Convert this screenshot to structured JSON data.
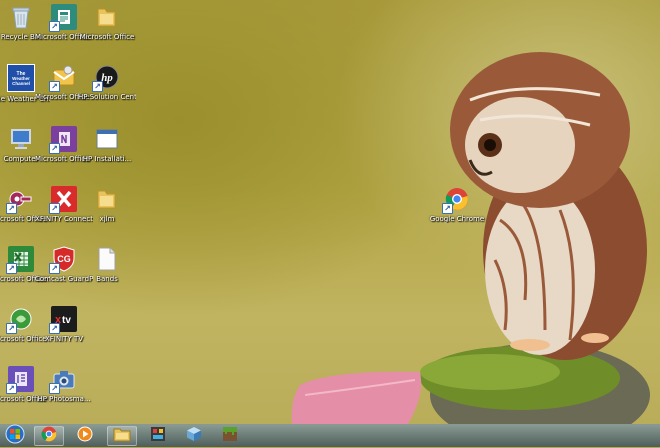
{
  "desktop": {
    "icons": [
      {
        "label": "Recycle Bin",
        "icon": "recycle-bin-icon"
      },
      {
        "label": "Microsoft Office P...",
        "icon": "office-publisher-icon"
      },
      {
        "label": "Microsoft Office",
        "icon": "folder-icon"
      },
      {
        "label": "The Weather Channel App",
        "icon": "weather-channel-icon"
      },
      {
        "label": "Microsoft Office Outl...",
        "icon": "outlook-icon"
      },
      {
        "label": "HP Solution Center",
        "icon": "hp-icon"
      },
      {
        "label": "Computer",
        "icon": "computer-icon"
      },
      {
        "label": "Microsoft Office ...",
        "icon": "onenote-icon"
      },
      {
        "label": "HP Installati...",
        "icon": "window-icon"
      },
      {
        "label": "Microsoft Office Acce...",
        "icon": "access-icon"
      },
      {
        "label": "XFINITY Connect",
        "icon": "xfinity-icon"
      },
      {
        "label": "xjlm",
        "icon": "folder-icon"
      },
      {
        "label": "Microsoft Office Exc...",
        "icon": "excel-icon"
      },
      {
        "label": "Comcast GuardPro...",
        "icon": "shield-icon"
      },
      {
        "label": "Bands",
        "icon": "document-icon"
      },
      {
        "label": "Microsoft Office Gro...",
        "icon": "groove-icon"
      },
      {
        "label": "XFINITY TV",
        "icon": "xfinity-tv-icon"
      },
      {
        "label": "Microsoft Office I...",
        "icon": "infopath-icon"
      },
      {
        "label": "HP Photosma...",
        "icon": "camera-icon"
      },
      {
        "label": "Google Chrome",
        "icon": "chrome-icon"
      }
    ]
  },
  "taskbar": {
    "items": [
      {
        "icon": "start-orb-icon"
      },
      {
        "icon": "chrome-icon"
      },
      {
        "icon": "media-player-icon"
      },
      {
        "icon": "file-explorer-icon"
      },
      {
        "icon": "game-icon"
      },
      {
        "icon": "cube-icon"
      },
      {
        "icon": "minecraft-icon"
      }
    ]
  }
}
